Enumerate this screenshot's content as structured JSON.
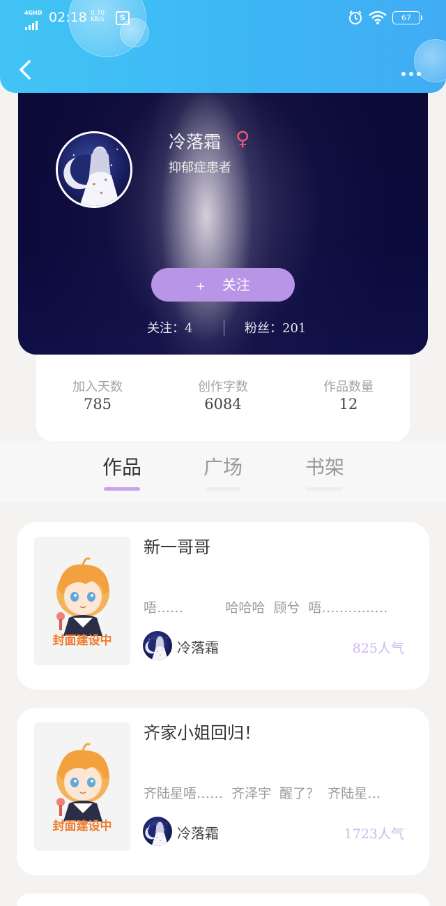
{
  "status_bar": {
    "network": "4GHD",
    "time": "02:18",
    "speed_value": "0.70",
    "speed_unit": "KB/s",
    "battery": "67"
  },
  "profile": {
    "name": "冷落霜",
    "gender_symbol": "♀",
    "bio": "抑郁症患者",
    "follow_plus": "+",
    "follow_label": "关注",
    "following": "关注：4",
    "fans": "粉丝：201"
  },
  "stats": [
    {
      "label": "加入天数",
      "value": "785"
    },
    {
      "label": "创作字数",
      "value": "6084"
    },
    {
      "label": "作品数量",
      "value": "12"
    }
  ],
  "tabs": [
    {
      "label": "作品",
      "active": true
    },
    {
      "label": "广场",
      "active": false
    },
    {
      "label": "书架",
      "active": false
    }
  ],
  "works": [
    {
      "title": "新一哥哥",
      "excerpt": "唔……          哈哈哈  顾兮  唔……………",
      "cover_text": "封面建设中",
      "author": "冷落霜",
      "popularity": "825人气"
    },
    {
      "title": "齐家小姐回归！",
      "excerpt": "齐陆星唔……  齐泽宇  醒了？  齐陆星…",
      "cover_text": "封面建设中",
      "author": "冷落霜",
      "popularity": "1723人气"
    }
  ],
  "colors": {
    "topbar": "#3eb8f5",
    "follow_button": "#b995e8",
    "tab_indicator": "#c8a4ee",
    "popularity": "#cbb6ee",
    "cover_text": "#f07c2d"
  }
}
